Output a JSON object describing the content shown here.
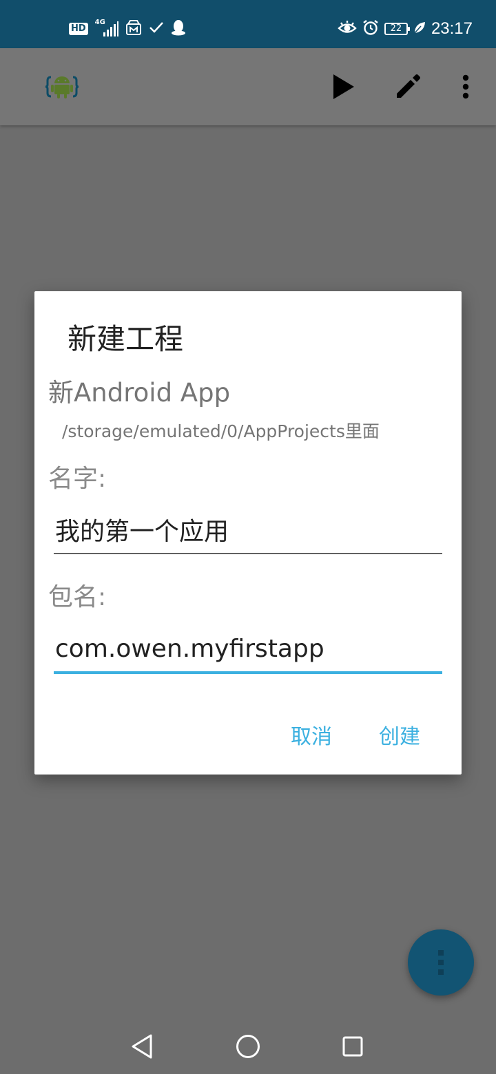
{
  "status_bar": {
    "left_badge": "HD",
    "network": "4G",
    "battery_level": "22",
    "time": "23:17"
  },
  "toolbar": {
    "logo_icon": "android-logo-icon",
    "actions": [
      {
        "name": "run",
        "icon": "play-icon"
      },
      {
        "name": "edit",
        "icon": "pencil-icon"
      },
      {
        "name": "more",
        "icon": "more-vert-icon"
      }
    ]
  },
  "dialog": {
    "title": "新建工程",
    "subtitle": "新Android App",
    "path": "/storage/emulated/0/AppProjects里面",
    "name_label": "名字:",
    "name_value": "我的第一个应用",
    "package_label": "包名:",
    "package_value": "com.owen.myfirstapp",
    "cancel_label": "取消",
    "create_label": "创建"
  },
  "fab": {
    "icon": "more-vert-icon"
  },
  "nav": {
    "back_icon": "back-triangle-icon",
    "home_icon": "home-circle-icon",
    "recent_icon": "recent-square-icon"
  },
  "colors": {
    "status_bar": "#114e6b",
    "accent": "#3bb0e0",
    "fab": "#125473",
    "scrim": "#6d6d6d"
  }
}
